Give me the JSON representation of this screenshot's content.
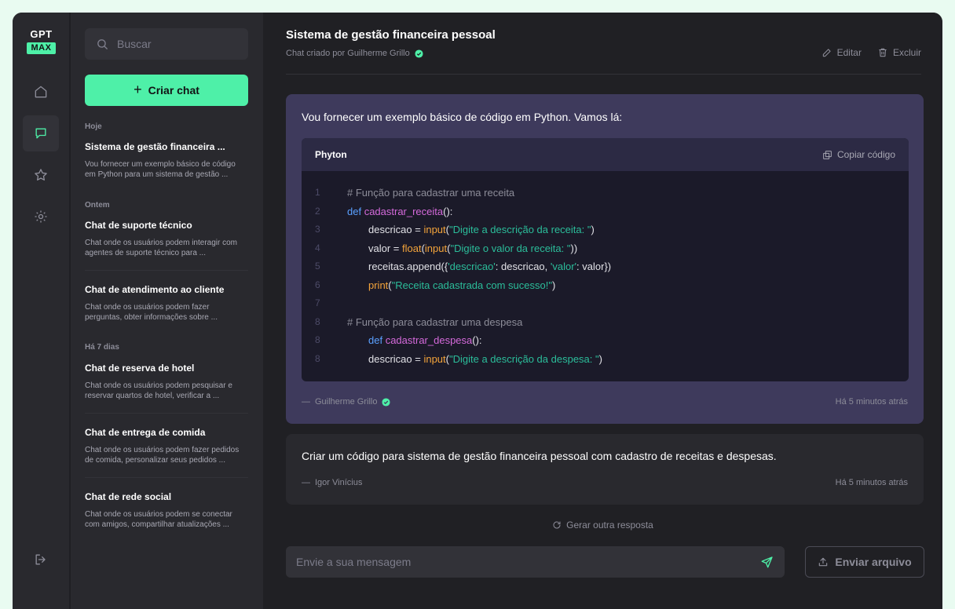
{
  "brand": {
    "line1": "GPT",
    "line2": "MAX"
  },
  "colors": {
    "accent": "#4ef0a8",
    "background": "#202024",
    "panel": "#29292e",
    "ai_bubble": "#3e3a5c",
    "code_bg": "#1b1a29"
  },
  "rail": {
    "items": [
      {
        "icon": "home-icon"
      },
      {
        "icon": "chat-icon",
        "active": true
      },
      {
        "icon": "star-icon"
      },
      {
        "icon": "gear-icon"
      }
    ],
    "logout_icon": "logout-icon"
  },
  "sidebar": {
    "search_placeholder": "Buscar",
    "create_label": "Criar chat",
    "sections": {
      "today": "Hoje",
      "yesterday": "Ontem",
      "week": "Há 7 dias"
    },
    "chats": [
      {
        "title": "Sistema de gestão financeira ...",
        "desc": "Vou fornecer um exemplo básico de código em Python para um sistema de gestão ..."
      },
      {
        "title": "Chat de suporte técnico",
        "desc": "Chat onde os usuários podem interagir com agentes de suporte técnico para ..."
      },
      {
        "title": "Chat de atendimento ao cliente",
        "desc": "Chat onde os usuários podem fazer perguntas, obter informações sobre ..."
      },
      {
        "title": "Chat de reserva de hotel",
        "desc": "Chat onde os usuários podem pesquisar e reservar quartos de hotel, verificar a ..."
      },
      {
        "title": "Chat de entrega de comida",
        "desc": "Chat onde os usuários podem fazer pedidos de comida, personalizar seus pedidos ..."
      },
      {
        "title": "Chat de rede social",
        "desc": "Chat onde os usuários podem se conectar com amigos, compartilhar atualizações ..."
      }
    ]
  },
  "header": {
    "title": "Sistema de gestão financeira pessoal",
    "subtitle": "Chat criado por Guilherme Grillo",
    "edit_label": "Editar",
    "delete_label": "Excluir"
  },
  "messages": {
    "ai": {
      "intro": "Vou fornecer um exemplo básico de código em Python. Vamos lá:",
      "code_lang": "Phyton",
      "copy_label": "Copiar código",
      "author": "Guilherme Grillo",
      "time": "Há 5 minutos atrás"
    },
    "user": {
      "text": "Criar um código para sistema de gestão financeira pessoal com cadastro de receitas e despesas.",
      "author": "Igor Vinícius",
      "time": "Há 5 minutos atrás"
    }
  },
  "code_lines": [
    {
      "num": "1",
      "indent": false,
      "parts": [
        [
          "c-com",
          "# Função para cadastrar uma receita"
        ]
      ]
    },
    {
      "num": "2",
      "indent": false,
      "parts": [
        [
          "c-kw",
          "def "
        ],
        [
          "c-fn",
          "cadastrar_receita"
        ],
        [
          "",
          "():"
        ]
      ]
    },
    {
      "num": "3",
      "indent": true,
      "parts": [
        [
          "",
          "descricao = "
        ],
        [
          "c-bi",
          "input"
        ],
        [
          "",
          "("
        ],
        [
          "c-str",
          "\"Digite a descrição da receita: \""
        ],
        [
          "",
          ")"
        ]
      ]
    },
    {
      "num": "4",
      "indent": true,
      "parts": [
        [
          "",
          "valor = "
        ],
        [
          "c-bi",
          "float"
        ],
        [
          "",
          "("
        ],
        [
          "c-bi",
          "input"
        ],
        [
          "",
          "("
        ],
        [
          "c-str",
          "\"Digite o valor da receita: \""
        ],
        [
          "",
          "))"
        ]
      ]
    },
    {
      "num": "5",
      "indent": true,
      "parts": [
        [
          "",
          "receitas.append({"
        ],
        [
          "c-str",
          "'descricao'"
        ],
        [
          "",
          ": descricao, "
        ],
        [
          "c-str",
          "'valor'"
        ],
        [
          "",
          ": valor})"
        ]
      ]
    },
    {
      "num": "6",
      "indent": true,
      "parts": [
        [
          "c-bi",
          "print"
        ],
        [
          "",
          "("
        ],
        [
          "c-str",
          "\"Receita cadastrada com sucesso!\""
        ],
        [
          "",
          ")"
        ]
      ]
    },
    {
      "num": "7",
      "indent": false,
      "parts": []
    },
    {
      "num": "8",
      "indent": false,
      "parts": [
        [
          "c-com",
          "# Função para cadastrar uma despesa"
        ]
      ]
    },
    {
      "num": "8",
      "indent": true,
      "parts": [
        [
          "c-kw",
          "def "
        ],
        [
          "c-fn",
          "cadastrar_despesa"
        ],
        [
          "",
          "():"
        ]
      ]
    },
    {
      "num": "8",
      "indent": true,
      "parts": [
        [
          "",
          "descricao = "
        ],
        [
          "c-bi",
          "input"
        ],
        [
          "",
          "("
        ],
        [
          "c-str",
          "\"Digite a descrição da despesa: \""
        ],
        [
          "",
          ")"
        ]
      ]
    }
  ],
  "regenerate_label": "Gerar outra resposta",
  "composer": {
    "placeholder": "Envie a sua mensagem",
    "upload_label": "Enviar arquivo"
  }
}
